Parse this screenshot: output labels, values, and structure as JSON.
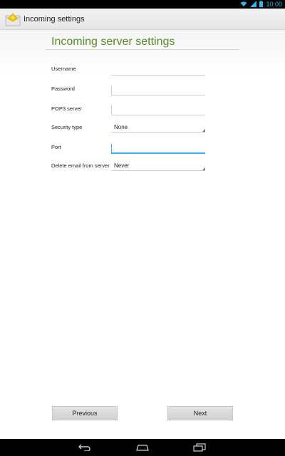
{
  "status_bar": {
    "time": "10:00",
    "icons": [
      "wifi-icon",
      "signal-icon",
      "battery-icon"
    ]
  },
  "action_bar": {
    "title": "Incoming settings",
    "icon": "email-app-icon"
  },
  "form": {
    "title": "Incoming server settings",
    "fields": [
      {
        "label": "Username",
        "value": "",
        "type": "text"
      },
      {
        "label": "Password",
        "value": "",
        "type": "password"
      },
      {
        "label": "POP3 server",
        "value": "",
        "type": "text"
      },
      {
        "label": "Security type",
        "value": "None",
        "type": "select"
      },
      {
        "label": "Port",
        "value": "",
        "type": "text",
        "focused": true
      },
      {
        "label": "Delete email from server",
        "value": "Never",
        "type": "select"
      }
    ]
  },
  "buttons": {
    "previous": "Previous",
    "next": "Next"
  },
  "nav_bar": {
    "icons": [
      "back-icon",
      "home-icon",
      "recent-apps-icon"
    ]
  },
  "colors": {
    "accent": "#33b5e5",
    "title_green": "#5a8a2b"
  }
}
